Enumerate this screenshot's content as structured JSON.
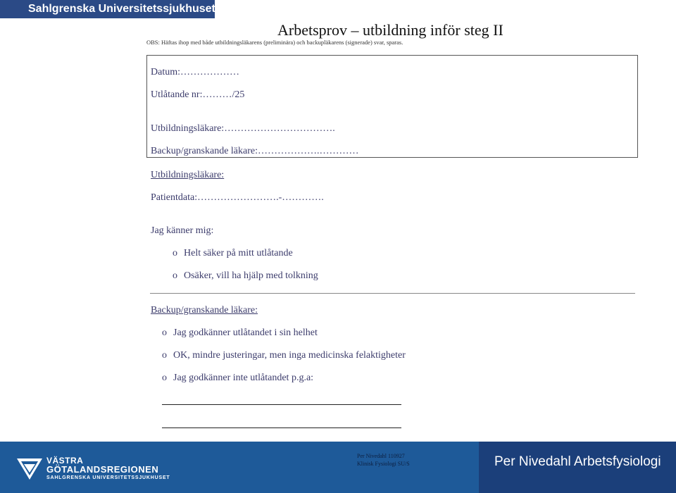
{
  "header": {
    "org": "Sahlgrenska Universitetssjukhuset"
  },
  "title": "Arbetsprov – utbildning inför steg II",
  "note": "OBS: Häftas ihop med både utbildningsläkarens (preliminära) och backupläkarens (signerade) svar, sparas.",
  "fields": {
    "datum": "Datum:………………",
    "utlatande": "Utlåtande nr:………/25",
    "utbildningslakare": "Utbildningsläkare:…………………………….",
    "backup": "Backup/granskande läkare:……………….…………"
  },
  "section1": {
    "heading": "Utbildningsläkare:",
    "patientdata": "Patientdata:…………………….-………….",
    "prompt": "Jag känner mig:",
    "options": [
      "Helt säker på mitt utlåtande",
      "Osäker, vill ha hjälp med tolkning"
    ]
  },
  "section2": {
    "heading": "Backup/granskande läkare:",
    "options": [
      "Jag godkänner utlåtandet i sin helhet",
      "OK, mindre justeringar, men inga medicinska felaktigheter",
      "Jag godkänner inte utlåtandet p.g.a:"
    ]
  },
  "bullet": "o",
  "footer": {
    "brand_line1": "VÄSTRA",
    "brand_line2": "GÖTALANDSREGIONEN",
    "brand_line3": "SAHLGRENSKA UNIVERSITETSSJUKHUSET",
    "small_line1": "Per Nivedahl 110927",
    "small_line2": "Klinisk Fysiologi SU/S",
    "big": "Per Nivedahl Arbetsfysiologi"
  }
}
